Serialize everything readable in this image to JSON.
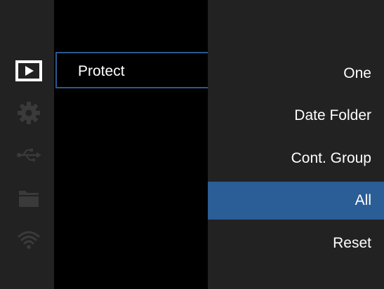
{
  "sidebar": {
    "icons": [
      {
        "name": "playback-icon",
        "active": true
      },
      {
        "name": "gear-icon",
        "active": false
      },
      {
        "name": "usb-icon",
        "active": false
      },
      {
        "name": "folder-icon",
        "active": false
      },
      {
        "name": "wifi-icon",
        "active": false
      }
    ]
  },
  "menu": {
    "selected_item": "Protect"
  },
  "options": {
    "items": [
      "One",
      "Date Folder",
      "Cont. Group",
      "All",
      "Reset"
    ],
    "selected": "All"
  },
  "colors": {
    "highlight": "#2b5d96",
    "focus_border": "#2c5a8f",
    "panel": "#222222",
    "background": "#000000",
    "inactive_icon": "#3a3a3a"
  }
}
